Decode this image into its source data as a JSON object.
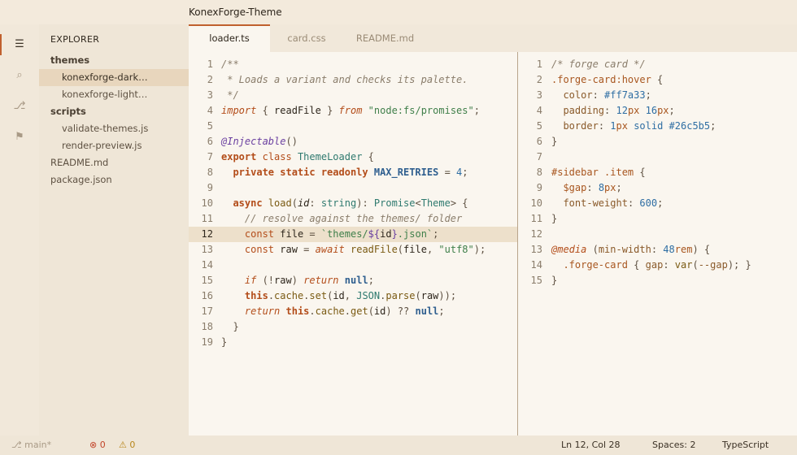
{
  "window": {
    "title": "KonexForge-Theme"
  },
  "activity_bar": {
    "items": [
      {
        "name": "explorer-icon",
        "glyph": "☰",
        "active": true
      },
      {
        "name": "search-icon",
        "glyph": "⌕",
        "active": false
      },
      {
        "name": "source-control-icon",
        "glyph": "⎇",
        "active": false
      },
      {
        "name": "flag-icon",
        "glyph": "⚑",
        "active": false
      }
    ]
  },
  "explorer": {
    "title": "EXPLORER",
    "tree": [
      {
        "label": "themes",
        "kind": "folder"
      },
      {
        "label": "konexforge-dark…",
        "kind": "file",
        "selected": true
      },
      {
        "label": "konexforge-light…",
        "kind": "file"
      },
      {
        "label": "scripts",
        "kind": "folder"
      },
      {
        "label": "validate-themes.js",
        "kind": "file"
      },
      {
        "label": "render-preview.js",
        "kind": "file"
      },
      {
        "label": "README.md",
        "kind": "root"
      },
      {
        "label": "package.json",
        "kind": "root"
      }
    ]
  },
  "tabs": [
    {
      "label": "loader.ts",
      "active": true
    },
    {
      "label": "card.css",
      "active": false
    },
    {
      "label": "README.md",
      "active": false
    }
  ],
  "editor_left": {
    "highlight_line": 12,
    "lines": [
      {
        "n": "1",
        "tokens": [
          [
            "cm",
            "/**"
          ]
        ]
      },
      {
        "n": "2",
        "tokens": [
          [
            "cm",
            " * Loads a variant and checks its palette."
          ]
        ]
      },
      {
        "n": "3",
        "tokens": [
          [
            "cm",
            " */"
          ]
        ]
      },
      {
        "n": "4",
        "tokens": [
          [
            "kwi",
            "import"
          ],
          [
            "pu",
            " { "
          ],
          [
            "id",
            "readFile"
          ],
          [
            "pu",
            " } "
          ],
          [
            "kwi",
            "from"
          ],
          [
            "pu",
            " "
          ],
          [
            "str",
            "\"node:fs/promises\""
          ],
          [
            "pu",
            ";"
          ]
        ]
      },
      {
        "n": "5",
        "tokens": []
      },
      {
        "n": "6",
        "tokens": [
          [
            "dec",
            "@Injectable"
          ],
          [
            "pu",
            "()"
          ]
        ]
      },
      {
        "n": "7",
        "tokens": [
          [
            "kw",
            "export"
          ],
          [
            "pu",
            " "
          ],
          [
            "kwp",
            "class"
          ],
          [
            "pu",
            " "
          ],
          [
            "ty",
            "ThemeLoader"
          ],
          [
            "pu",
            " {"
          ]
        ]
      },
      {
        "n": "8",
        "tokens": [
          [
            "pu",
            "  "
          ],
          [
            "kw",
            "private static readonly"
          ],
          [
            "pu",
            " "
          ],
          [
            "const",
            "MAX_RETRIES"
          ],
          [
            "pu",
            " = "
          ],
          [
            "num",
            "4"
          ],
          [
            "pu",
            ";"
          ]
        ]
      },
      {
        "n": "9",
        "tokens": []
      },
      {
        "n": "10",
        "tokens": [
          [
            "pu",
            "  "
          ],
          [
            "kw",
            "async"
          ],
          [
            "pu",
            " "
          ],
          [
            "fn",
            "load"
          ],
          [
            "pu",
            "("
          ],
          [
            "pa",
            "id"
          ],
          [
            "pu",
            ": "
          ],
          [
            "ty",
            "string"
          ],
          [
            "pu",
            "): "
          ],
          [
            "ty",
            "Promise"
          ],
          [
            "pu",
            "<"
          ],
          [
            "ty",
            "Theme"
          ],
          [
            "pu",
            "> {"
          ]
        ]
      },
      {
        "n": "11",
        "tokens": [
          [
            "pu",
            "    "
          ],
          [
            "cm",
            "// resolve against the themes/ folder"
          ]
        ]
      },
      {
        "n": "12",
        "tokens": [
          [
            "pu",
            "    "
          ],
          [
            "kwp",
            "const"
          ],
          [
            "pu",
            " "
          ],
          [
            "id",
            "file"
          ],
          [
            "pu",
            " = "
          ],
          [
            "str",
            "`themes/"
          ],
          [
            "tmpl",
            "${"
          ],
          [
            "id",
            "id"
          ],
          [
            "tmpl",
            "}"
          ],
          [
            "str",
            ".json`"
          ],
          [
            "pu",
            ";"
          ]
        ]
      },
      {
        "n": "13",
        "tokens": [
          [
            "pu",
            "    "
          ],
          [
            "kwp",
            "const"
          ],
          [
            "pu",
            " "
          ],
          [
            "id",
            "raw"
          ],
          [
            "pu",
            " = "
          ],
          [
            "kwi",
            "await"
          ],
          [
            "pu",
            " "
          ],
          [
            "fn",
            "readFile"
          ],
          [
            "pu",
            "("
          ],
          [
            "id",
            "file"
          ],
          [
            "pu",
            ", "
          ],
          [
            "str",
            "\"utf8\""
          ],
          [
            "pu",
            ");"
          ]
        ]
      },
      {
        "n": "14",
        "tokens": []
      },
      {
        "n": "15",
        "tokens": [
          [
            "pu",
            "    "
          ],
          [
            "kwi",
            "if"
          ],
          [
            "pu",
            " (!"
          ],
          [
            "id",
            "raw"
          ],
          [
            "pu",
            ") "
          ],
          [
            "kwi",
            "return"
          ],
          [
            "pu",
            " "
          ],
          [
            "const",
            "null"
          ],
          [
            "pu",
            ";"
          ]
        ]
      },
      {
        "n": "16",
        "tokens": [
          [
            "pu",
            "    "
          ],
          [
            "kw",
            "this"
          ],
          [
            "pu",
            "."
          ],
          [
            "fn",
            "cache"
          ],
          [
            "pu",
            "."
          ],
          [
            "fn",
            "set"
          ],
          [
            "pu",
            "("
          ],
          [
            "id",
            "id"
          ],
          [
            "pu",
            ", "
          ],
          [
            "ty",
            "JSON"
          ],
          [
            "pu",
            "."
          ],
          [
            "fn",
            "parse"
          ],
          [
            "pu",
            "("
          ],
          [
            "id",
            "raw"
          ],
          [
            "pu",
            "));"
          ]
        ]
      },
      {
        "n": "17",
        "tokens": [
          [
            "pu",
            "    "
          ],
          [
            "kwi",
            "return"
          ],
          [
            "pu",
            " "
          ],
          [
            "kw",
            "this"
          ],
          [
            "pu",
            "."
          ],
          [
            "fn",
            "cache"
          ],
          [
            "pu",
            "."
          ],
          [
            "fn",
            "get"
          ],
          [
            "pu",
            "("
          ],
          [
            "id",
            "id"
          ],
          [
            "pu",
            ") ?? "
          ],
          [
            "const",
            "null"
          ],
          [
            "pu",
            ";"
          ]
        ]
      },
      {
        "n": "18",
        "tokens": [
          [
            "pu",
            "  }"
          ]
        ]
      },
      {
        "n": "19",
        "tokens": [
          [
            "pu",
            "}"
          ]
        ]
      }
    ]
  },
  "editor_right": {
    "lines": [
      {
        "n": "1",
        "tokens": [
          [
            "cm",
            "/* forge card */"
          ]
        ]
      },
      {
        "n": "2",
        "tokens": [
          [
            "sel",
            ".forge-card:hover"
          ],
          [
            "pu",
            " {"
          ]
        ]
      },
      {
        "n": "3",
        "tokens": [
          [
            "pu",
            "  "
          ],
          [
            "pr",
            "color"
          ],
          [
            "pu",
            ": "
          ],
          [
            "hx",
            "#ff7a33"
          ],
          [
            "pu",
            ";"
          ]
        ]
      },
      {
        "n": "4",
        "tokens": [
          [
            "pu",
            "  "
          ],
          [
            "pr",
            "padding"
          ],
          [
            "pu",
            ": "
          ],
          [
            "num",
            "12"
          ],
          [
            "sel",
            "px"
          ],
          [
            "pu",
            " "
          ],
          [
            "num",
            "16"
          ],
          [
            "sel",
            "px"
          ],
          [
            "pu",
            ";"
          ]
        ]
      },
      {
        "n": "5",
        "tokens": [
          [
            "pu",
            "  "
          ],
          [
            "pr",
            "border"
          ],
          [
            "pu",
            ": "
          ],
          [
            "num",
            "1"
          ],
          [
            "sel",
            "px"
          ],
          [
            "pu",
            " "
          ],
          [
            "hx",
            "solid"
          ],
          [
            "pu",
            " "
          ],
          [
            "hx",
            "#26c5b5"
          ],
          [
            "pu",
            ";"
          ]
        ]
      },
      {
        "n": "6",
        "tokens": [
          [
            "pu",
            "}"
          ]
        ]
      },
      {
        "n": "7",
        "tokens": []
      },
      {
        "n": "8",
        "tokens": [
          [
            "sel",
            "#sidebar .item"
          ],
          [
            "pu",
            " {"
          ]
        ]
      },
      {
        "n": "9",
        "tokens": [
          [
            "pu",
            "  "
          ],
          [
            "var",
            "$gap"
          ],
          [
            "pu",
            ": "
          ],
          [
            "num",
            "8"
          ],
          [
            "sel",
            "px"
          ],
          [
            "pu",
            ";"
          ]
        ]
      },
      {
        "n": "10",
        "tokens": [
          [
            "pu",
            "  "
          ],
          [
            "pr",
            "font-weight"
          ],
          [
            "pu",
            ": "
          ],
          [
            "num",
            "600"
          ],
          [
            "pu",
            ";"
          ]
        ]
      },
      {
        "n": "11",
        "tokens": [
          [
            "pu",
            "}"
          ]
        ]
      },
      {
        "n": "12",
        "tokens": []
      },
      {
        "n": "13",
        "tokens": [
          [
            "kwi",
            "@media"
          ],
          [
            "pu",
            " ("
          ],
          [
            "pr",
            "min-width"
          ],
          [
            "pu",
            ": "
          ],
          [
            "num",
            "48"
          ],
          [
            "sel",
            "rem"
          ],
          [
            "pu",
            ") {"
          ]
        ]
      },
      {
        "n": "14",
        "tokens": [
          [
            "pu",
            "  "
          ],
          [
            "sel",
            ".forge-card"
          ],
          [
            "pu",
            " { "
          ],
          [
            "pr",
            "gap"
          ],
          [
            "pu",
            ": "
          ],
          [
            "fn",
            "var"
          ],
          [
            "pu",
            "("
          ],
          [
            "pr",
            "--gap"
          ],
          [
            "pu",
            "); }"
          ]
        ]
      },
      {
        "n": "15",
        "tokens": [
          [
            "pu",
            "}"
          ]
        ]
      }
    ]
  },
  "status_bar": {
    "branch": "⎇ main*",
    "errors": "⊗ 0",
    "warnings": "⚠ 0",
    "position": "Ln 12, Col 28",
    "indent": "Spaces: 2",
    "language": "TypeScript"
  },
  "colors": {
    "accent": "#c0602e",
    "editor_bg": "#faf6ef",
    "sidebar_bg": "#efe6d7",
    "selection": "#e8d6bd"
  }
}
